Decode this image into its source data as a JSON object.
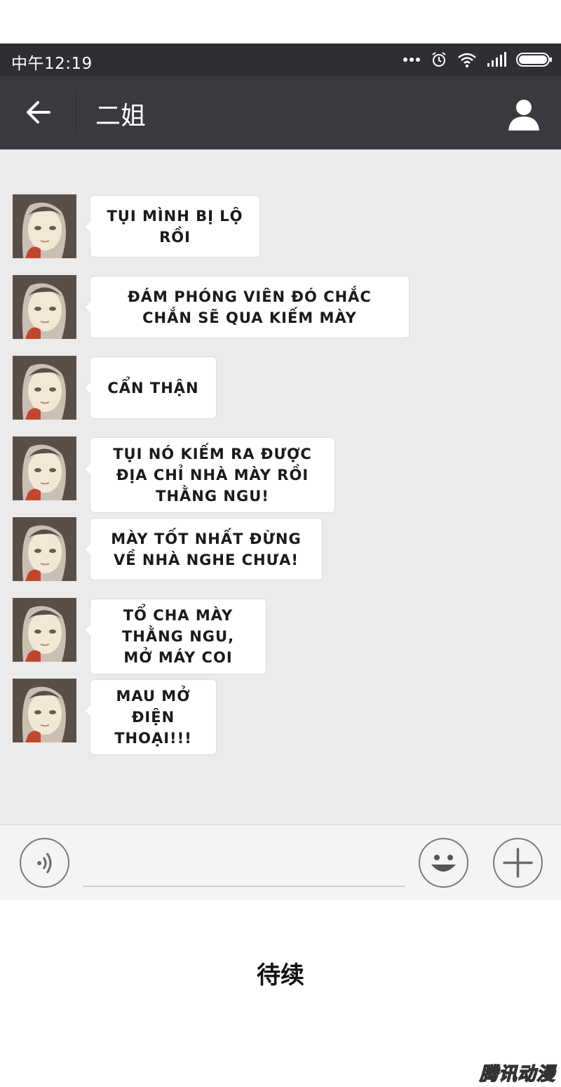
{
  "status_bar": {
    "time": "中午12:19",
    "icons": [
      "more-dots-icon",
      "alarm-icon",
      "wifi-icon",
      "signal-icon",
      "battery-icon"
    ]
  },
  "header": {
    "title": "二姐",
    "back_icon": "back-arrow-icon",
    "profile_icon": "person-icon"
  },
  "messages": [
    {
      "text": "TỤI MÌNH BỊ LỘ RỒI"
    },
    {
      "text": "ĐÁM PHÓNG VIÊN ĐÓ CHẮC CHẮN SẼ QUA KIẾM MÀY"
    },
    {
      "text": "CẨN THẬN"
    },
    {
      "text": "TỤI NÓ KIẾM RA ĐƯỢC ĐỊA CHỈ NHÀ MÀY RỒI THẰNG NGU!"
    },
    {
      "text": "MÀY TỐT NHẤT ĐỪNG VỀ NHÀ NGHE CHƯA!"
    },
    {
      "text": "TỔ CHA MÀY THẰNG NGU, MỞ MÁY COI"
    },
    {
      "text": "MAU MỞ ĐIỆN THOẠI!!!"
    }
  ],
  "input_bar": {
    "voice_icon": "voice-icon",
    "emoji_icon": "emoji-icon",
    "plus_icon": "plus-icon",
    "input_value": ""
  },
  "footer": {
    "caption": "待续",
    "watermark": "腾讯动漫"
  },
  "colors": {
    "status_bar": "#2d2f33",
    "header": "#393a3f",
    "chat_background": "#ebebeb",
    "bubble": "#ffffff"
  }
}
